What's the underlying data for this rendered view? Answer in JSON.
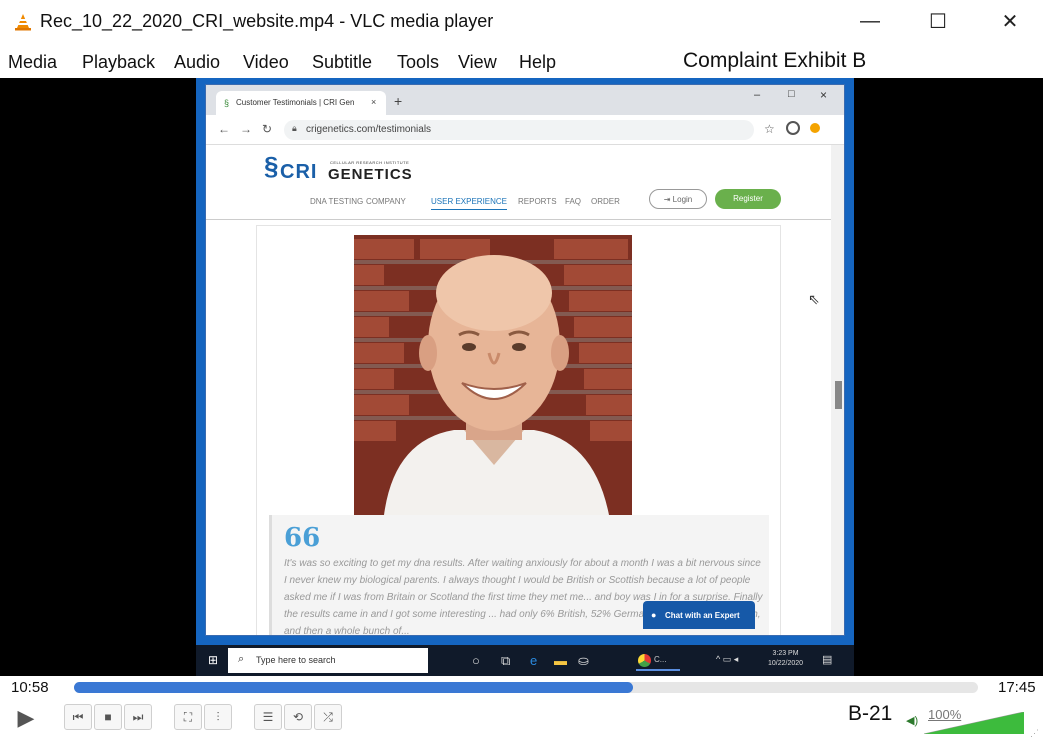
{
  "window": {
    "title": "Rec_10_22_2020_CRI_website.mp4 - VLC media player",
    "min_glyph": "—",
    "max_glyph": "☐",
    "close_glyph": "✕"
  },
  "menu": {
    "items": [
      "Media",
      "Playback",
      "Audio",
      "Video",
      "Subtitle",
      "Tools",
      "View",
      "Help"
    ],
    "exhibit_label": "Complaint Exhibit B"
  },
  "browser": {
    "tab_title": "Customer Testimonials | CRI Gen",
    "tab_close": "×",
    "new_tab": "+",
    "url": "crigenetics.com/testimonials",
    "controls": {
      "min": "–",
      "max": "□",
      "close": "×"
    }
  },
  "site": {
    "logo_cri": "CRI",
    "logo_sub": "CELLULAR RESEARCH INSTITUTE",
    "logo_genetics": "GENETICS",
    "nav": [
      "DNA TESTING",
      "COMPANY",
      "USER EXPERIENCE",
      "REPORTS",
      "FAQ",
      "ORDER"
    ],
    "active_nav": "USER EXPERIENCE",
    "login_label": "Login",
    "register_label": "Register",
    "quote_mark": "66",
    "testimonial_text": "It's was so exciting to get my dna results. After waiting anxiously for about a month I was a bit nervous since I never knew my biological parents. I always thought I would be British or Scottish because a lot of people asked me if I was from Britain or Scotland the first time they met me... and boy was I in for a surprise. Finally the results came in and I got some interesting ... had only 6% British, 52% German, 25% Asian, no Scottish, and then a whole bunch of...",
    "chat_label": "Chat with an Expert"
  },
  "taskbar": {
    "search_placeholder": "Type here to search",
    "chrome_label": "C...",
    "clock_time": "3:23 PM",
    "clock_date": "10/22/2020"
  },
  "player": {
    "elapsed": "10:58",
    "total": "17:45",
    "progress_fraction": 0.618,
    "badge": "B-21",
    "volume_label": "100%",
    "volume_fraction": 1.0
  },
  "colors": {
    "seek_fill": "#3a78d4",
    "vlc_orange": "#f08a00",
    "register_green": "#6ab04c",
    "chat_blue": "#1659a8",
    "desktop_blue": "#1565c0"
  }
}
